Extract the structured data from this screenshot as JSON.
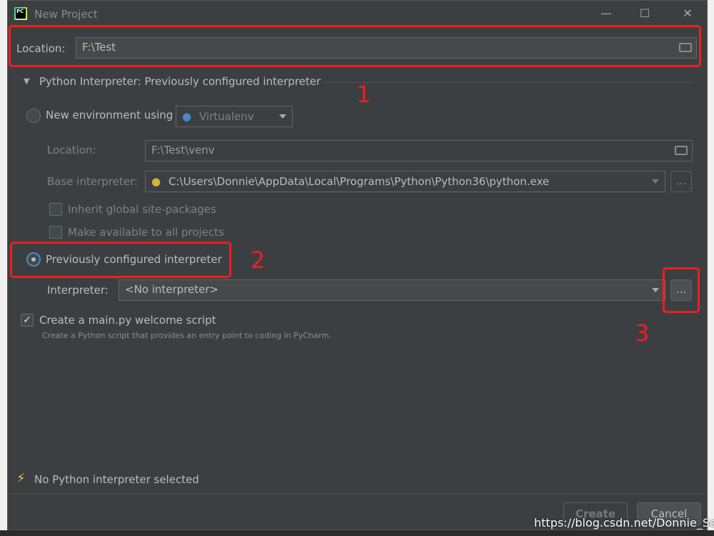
{
  "window": {
    "title": "New Project"
  },
  "location": {
    "label": "Location:",
    "value": "F:\\Test"
  },
  "interpreter_section": {
    "title": "Python Interpreter: Previously configured interpreter"
  },
  "new_env": {
    "label": "New environment using",
    "tool": "Virtualenv",
    "location_label": "Location:",
    "location_value": "F:\\Test\\venv",
    "base_label": "Base interpreter:",
    "base_value": "C:\\Users\\Donnie\\AppData\\Local\\Programs\\Python\\Python36\\python.exe",
    "inherit_label": "Inherit global site-packages",
    "make_available_label": "Make available to all projects"
  },
  "previous": {
    "label": "Previously configured interpreter",
    "interpreter_label": "Interpreter:",
    "interpreter_value": "<No interpreter>",
    "browse_label": "..."
  },
  "welcome": {
    "label": "Create a main.py welcome script",
    "hint": "Create a Python script that provides an entry point to coding in PyCharm.",
    "checked": true
  },
  "status": {
    "text": "No Python interpreter selected"
  },
  "buttons": {
    "create": "Create",
    "cancel": "Cancel"
  },
  "annotations": [
    "1",
    "2",
    "3"
  ],
  "watermark": "https://blog.csdn.net/Donnie_Song",
  "colors": {
    "dialog_bg": "#3c3f41",
    "highlight": "#f01e1e",
    "accent": "#4a88c7"
  }
}
